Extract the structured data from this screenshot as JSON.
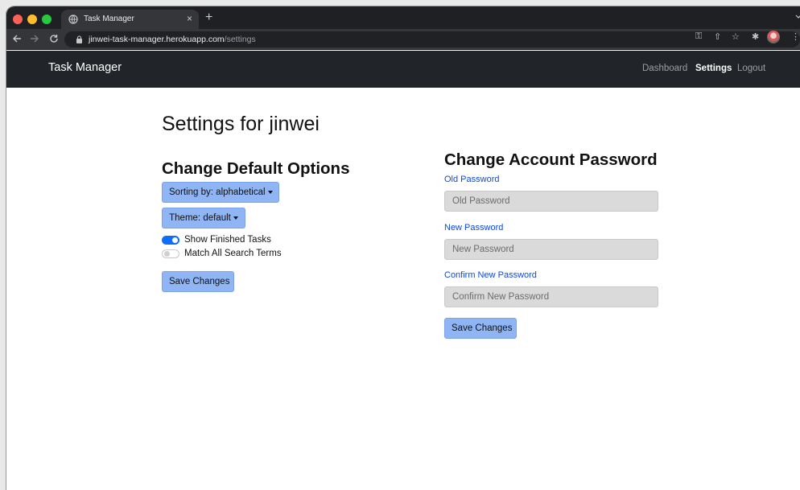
{
  "browser": {
    "tab_title": "Task Manager",
    "tab_close": "×",
    "new_tab": "+",
    "url_host": "jinwei-task-manager.herokuapp.com",
    "url_path": "/settings",
    "icons": [
      "back-icon",
      "forward-icon",
      "reload-icon",
      "lock-icon",
      "key-icon",
      "share-icon",
      "star-icon",
      "extensions-icon",
      "profile-avatar",
      "menu-icon"
    ]
  },
  "navbar": {
    "brand": "Task Manager",
    "links": [
      "Dashboard",
      "Settings",
      "Logout"
    ],
    "active": "Settings"
  },
  "page": {
    "title": "Settings for jinwei"
  },
  "defaults": {
    "heading": "Change Default Options",
    "sorting_label": "Sorting by: alphabetical",
    "theme_label": "Theme: default",
    "toggles": [
      {
        "label": "Show Finished Tasks",
        "on": true
      },
      {
        "label": "Match All Search Terms",
        "on": false
      }
    ],
    "save_label": "Save Changes"
  },
  "password": {
    "heading": "Change Account Password",
    "fields": [
      {
        "label": "Old Password",
        "placeholder": "Old Password",
        "value": ""
      },
      {
        "label": "New Password",
        "placeholder": "New Password",
        "value": ""
      },
      {
        "label": "Confirm New Password",
        "placeholder": "Confirm New Password",
        "value": ""
      }
    ],
    "save_label": "Save Changes"
  },
  "colors": {
    "navbar_bg": "#212529",
    "button_bg": "#8fb5f5",
    "toggle_on": "#0d6efd",
    "label_blue": "#0d47e8"
  }
}
